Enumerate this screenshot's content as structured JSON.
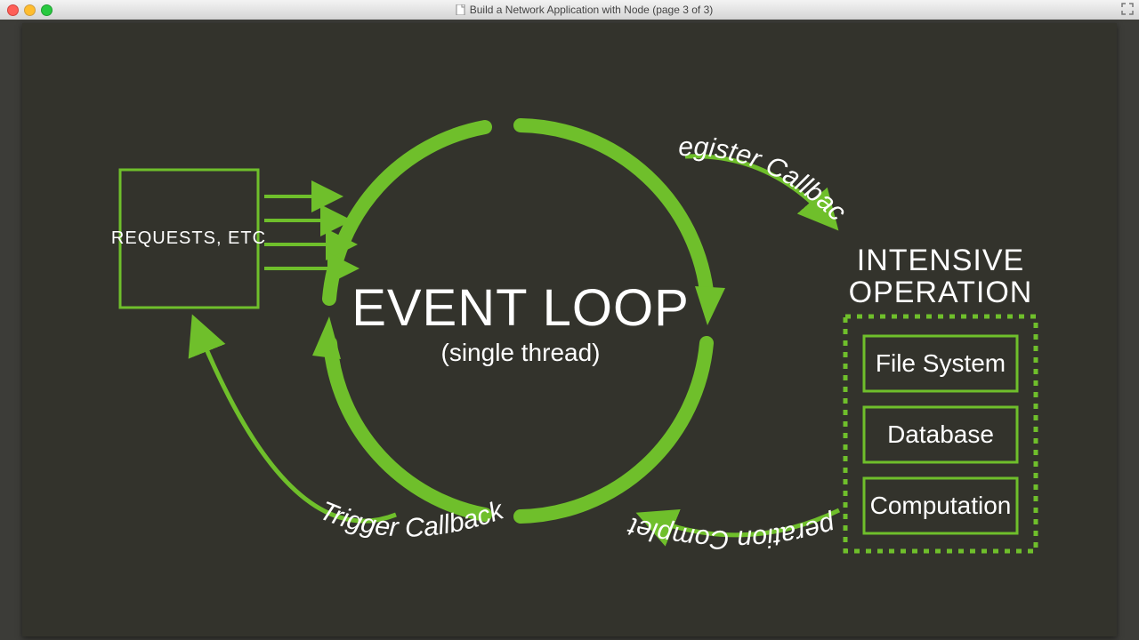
{
  "window": {
    "title": "Build a Network Application with Node (page 3 of 3)"
  },
  "diagram": {
    "colors": {
      "accent": "#6fbf2b",
      "bg": "#33332c",
      "text": "#ffffff"
    },
    "requests_box": {
      "label": "REQUESTS, ETC"
    },
    "event_loop": {
      "title": "EVENT LOOP",
      "subtitle": "(single thread)"
    },
    "intensive": {
      "title_line1": "INTENSIVE",
      "title_line2": "OPERATION",
      "items": [
        "File System",
        "Database",
        "Computation"
      ]
    },
    "arrows": {
      "register": "Register Callback",
      "complete": "Operation Complete",
      "trigger": "Trigger Callback"
    }
  }
}
